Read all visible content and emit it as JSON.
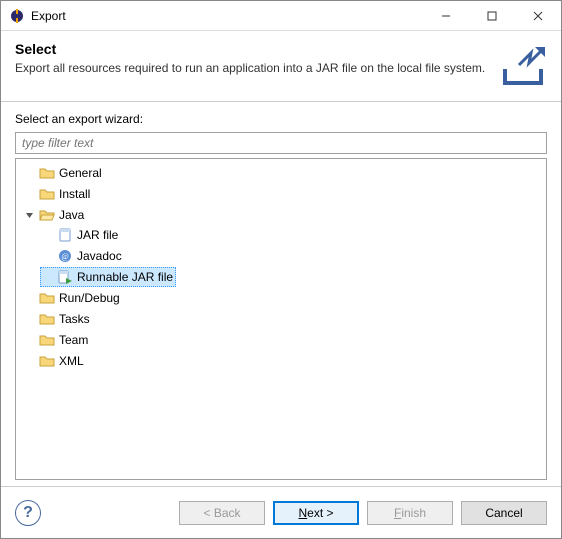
{
  "window": {
    "title": "Export"
  },
  "header": {
    "title": "Select",
    "description": "Export all resources required to run an application into a JAR file on the local file system."
  },
  "body": {
    "label": "Select an export wizard:",
    "filter_placeholder": "type filter text"
  },
  "tree": {
    "items": [
      {
        "label": "General",
        "expanded": false,
        "icon": "folder"
      },
      {
        "label": "Install",
        "expanded": false,
        "icon": "folder"
      },
      {
        "label": "Java",
        "expanded": true,
        "icon": "folder",
        "children": [
          {
            "label": "JAR file",
            "icon": "jar"
          },
          {
            "label": "Javadoc",
            "icon": "javadoc"
          },
          {
            "label": "Runnable JAR file",
            "icon": "jar-run",
            "selected": true
          }
        ]
      },
      {
        "label": "Run/Debug",
        "expanded": false,
        "icon": "folder"
      },
      {
        "label": "Tasks",
        "expanded": false,
        "icon": "folder"
      },
      {
        "label": "Team",
        "expanded": false,
        "icon": "folder"
      },
      {
        "label": "XML",
        "expanded": false,
        "icon": "folder"
      }
    ]
  },
  "footer": {
    "back": "< Back",
    "next": "Next >",
    "finish": "Finish",
    "cancel": "Cancel"
  }
}
